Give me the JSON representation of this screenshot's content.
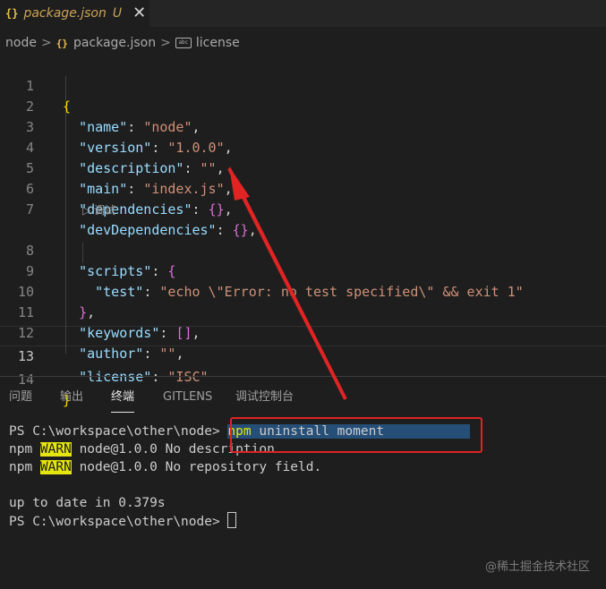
{
  "tab": {
    "icon": "json-braces-icon",
    "icon_text": "{}",
    "filename": "package.json",
    "status": "U",
    "close": "✕"
  },
  "breadcrumb": {
    "items": [
      "node",
      "package.json",
      "license"
    ],
    "sep": ">",
    "abc": "abc"
  },
  "editor": {
    "line_numbers": [
      "1",
      "2",
      "3",
      "4",
      "5",
      "6",
      "7",
      "8",
      "9",
      "10",
      "11",
      "12",
      "13",
      "14"
    ],
    "codelens": "▷ 调试",
    "l1": "{",
    "l2": {
      "key": "\"name\"",
      "val": "\"node\""
    },
    "l3": {
      "key": "\"version\"",
      "val": "\"1.0.0\""
    },
    "l4": {
      "key": "\"description\"",
      "val": "\"\""
    },
    "l5": {
      "key": "\"main\"",
      "val": "\"index.js\""
    },
    "l6": {
      "key": "\"dependencies\"",
      "val": "{}"
    },
    "l7": {
      "key": "\"devDependencies\"",
      "val": "{}"
    },
    "l8": {
      "key": "\"scripts\"",
      "val": "{"
    },
    "l9": {
      "key": "\"test\"",
      "val": "\"echo \\\"Error: no test specified\\\" && exit 1\""
    },
    "l10": "}",
    "l11": {
      "key": "\"keywords\"",
      "val": "[]"
    },
    "l12": {
      "key": "\"author\"",
      "val": "\"\""
    },
    "l13": {
      "key": "\"license\"",
      "val": "\"ISC\""
    },
    "l14": "}",
    "colon": ": ",
    "comma": ","
  },
  "panel": {
    "tabs": [
      "问题",
      "输出",
      "终端",
      "GITLENS",
      "调试控制台"
    ],
    "active": "终端"
  },
  "terminal": {
    "prompt": "PS C:\\workspace\\other\\node> ",
    "cmd_npm": "npm",
    "cmd_rest": " uninstall moment",
    "warn1_pre": "npm ",
    "warn_tag": "WARN",
    "warn1_msg": " node@1.0.0 No description",
    "warn2_msg": " node@1.0.0 No repository field.",
    "uptodate": "up to date in 0.379s"
  },
  "watermark": "@稀土掘金技术社区",
  "colors": {
    "annotation": "#e02424",
    "warn_bg": "#e5e510",
    "selection": "#264f78"
  }
}
